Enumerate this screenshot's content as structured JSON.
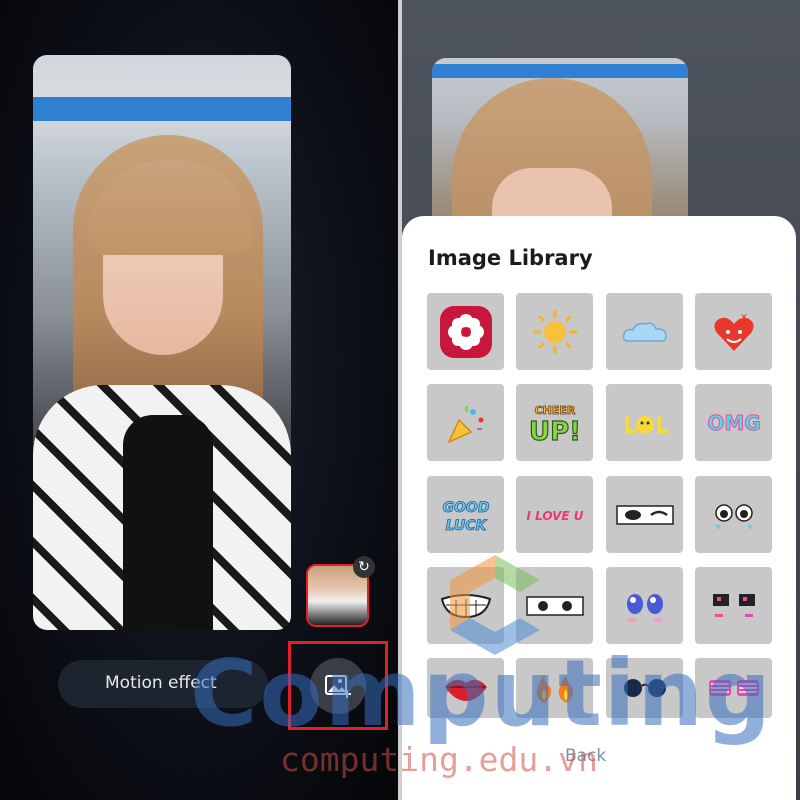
{
  "left_panel": {
    "motion_effect_label": "Motion effect",
    "add_image_icon": "image-add-icon",
    "refresh_icon": "refresh-icon",
    "highlight_color": "#e0202a"
  },
  "image_library": {
    "title": "Image Library",
    "back_label": "Back",
    "stickers": [
      {
        "name": "gallery-flower"
      },
      {
        "name": "sun"
      },
      {
        "name": "cloud"
      },
      {
        "name": "heart-love"
      },
      {
        "name": "party-popper"
      },
      {
        "name": "cheer-up",
        "text": "CHEER UP!"
      },
      {
        "name": "lol",
        "text": "LOL"
      },
      {
        "name": "omg",
        "text": "OMG"
      },
      {
        "name": "good-luck",
        "text": "GOOD LUCK"
      },
      {
        "name": "i-love-u",
        "text": "I LOVE U"
      },
      {
        "name": "winking-eyes"
      },
      {
        "name": "teary-eyes"
      },
      {
        "name": "grinning-mouth"
      },
      {
        "name": "wide-eyes"
      },
      {
        "name": "cute-eyes"
      },
      {
        "name": "pixel-eyes"
      },
      {
        "name": "kiss-lips"
      },
      {
        "name": "fire-eyes"
      },
      {
        "name": "round-sunglasses"
      },
      {
        "name": "shutter-shades"
      }
    ]
  },
  "watermark": {
    "brand": "Computing",
    "url": "computing.edu.vn"
  }
}
